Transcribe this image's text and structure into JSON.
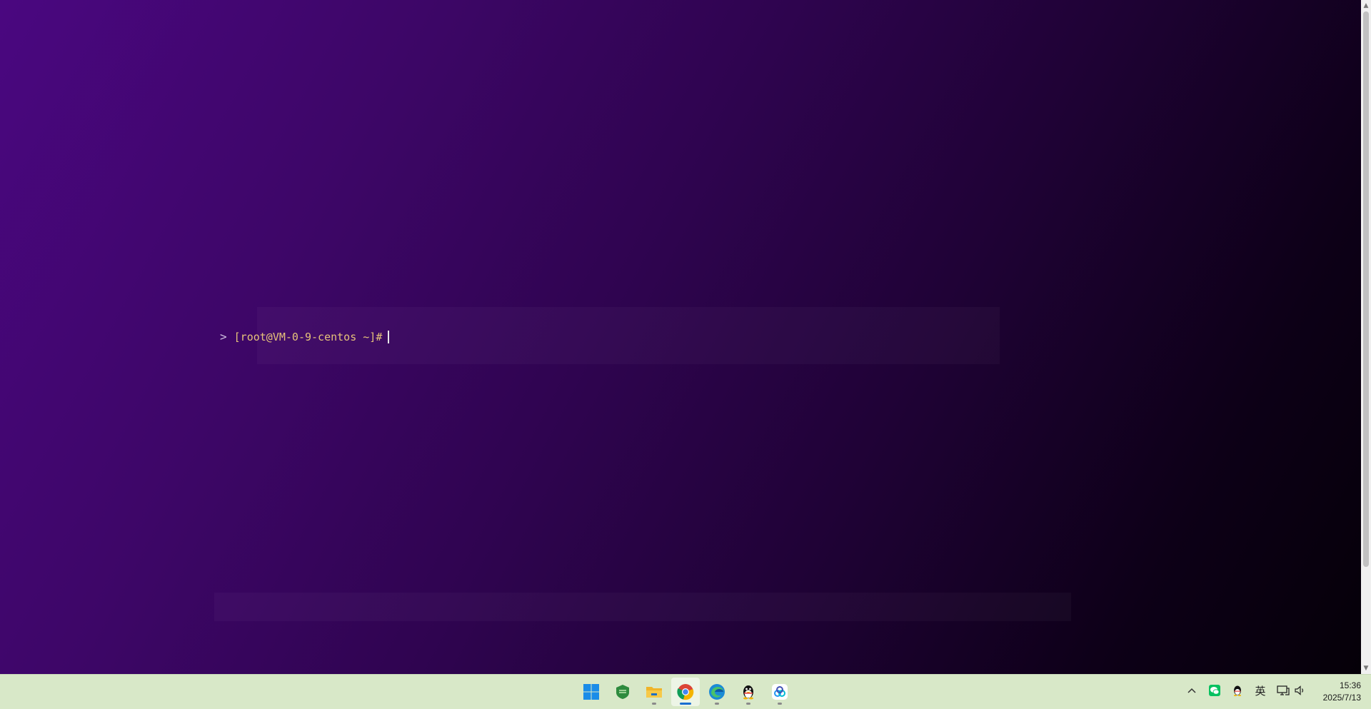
{
  "terminal": {
    "prompt_arrow": ">",
    "prompt_text": "[root@VM-0-9-centos ~]#"
  },
  "taskbar": {
    "apps": [
      {
        "name": "start-icon",
        "active": false
      },
      {
        "name": "security-shield-icon",
        "active": false
      },
      {
        "name": "file-explorer-icon",
        "active": false
      },
      {
        "name": "chrome-icon",
        "active": true
      },
      {
        "name": "edge-icon",
        "active": false
      },
      {
        "name": "qq-icon",
        "active": false
      },
      {
        "name": "cloud-app-icon",
        "active": false
      }
    ],
    "tray": {
      "chevron": "^",
      "ime": "英",
      "speaker": "🔈"
    },
    "clock": {
      "time": "15:36",
      "date": "2025/7/13"
    }
  },
  "colors": {
    "accent": "#1a6fd0",
    "taskbar_bg": "#d8e8c8",
    "prompt": "#e6c27a"
  }
}
